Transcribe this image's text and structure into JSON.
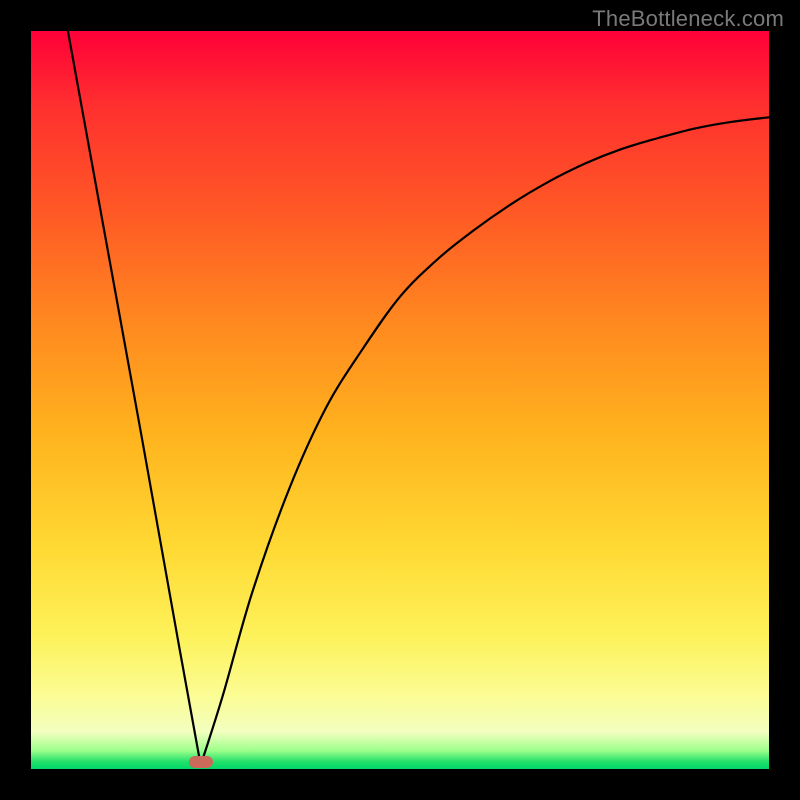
{
  "watermark": "TheBottleneck.com",
  "colors": {
    "frame": "#000000",
    "curve": "#000000",
    "marker": "#c96a5a",
    "gradient_stops": [
      "#ff0038",
      "#ff2f2f",
      "#ff5a25",
      "#ff8a1f",
      "#ffb41e",
      "#ffd933",
      "#fdf25a",
      "#fbfc93",
      "#f2ffbf",
      "#9dff8b",
      "#22e06a",
      "#00d868"
    ]
  },
  "chart_data": {
    "type": "line",
    "title": "",
    "xlabel": "",
    "ylabel": "",
    "xlim": [
      0,
      100
    ],
    "ylim": [
      0,
      100
    ],
    "grid": false,
    "legend": false,
    "annotations": [
      {
        "name": "marker",
        "x": 23,
        "y": 1,
        "shape": "pill",
        "color": "#c96a5a"
      }
    ],
    "note": "Single V-shaped bottleneck curve. Left branch roughly linear from (5,100) to minimum; right branch rises with decreasing slope toward (100,~88). Values estimated from pixels; no axis ticks shown.",
    "series": [
      {
        "name": "bottleneck-curve",
        "x": [
          5,
          10,
          15,
          20,
          23,
          26,
          30,
          35,
          40,
          45,
          50,
          55,
          60,
          65,
          70,
          75,
          80,
          85,
          90,
          95,
          100
        ],
        "y": [
          100,
          72.5,
          45,
          17,
          0.5,
          10,
          24,
          38,
          49,
          57,
          64,
          69,
          73,
          76.5,
          79.5,
          82,
          84,
          85.5,
          86.8,
          87.7,
          88.3
        ]
      }
    ],
    "minimum": {
      "x": 23,
      "y": 0.5
    }
  }
}
